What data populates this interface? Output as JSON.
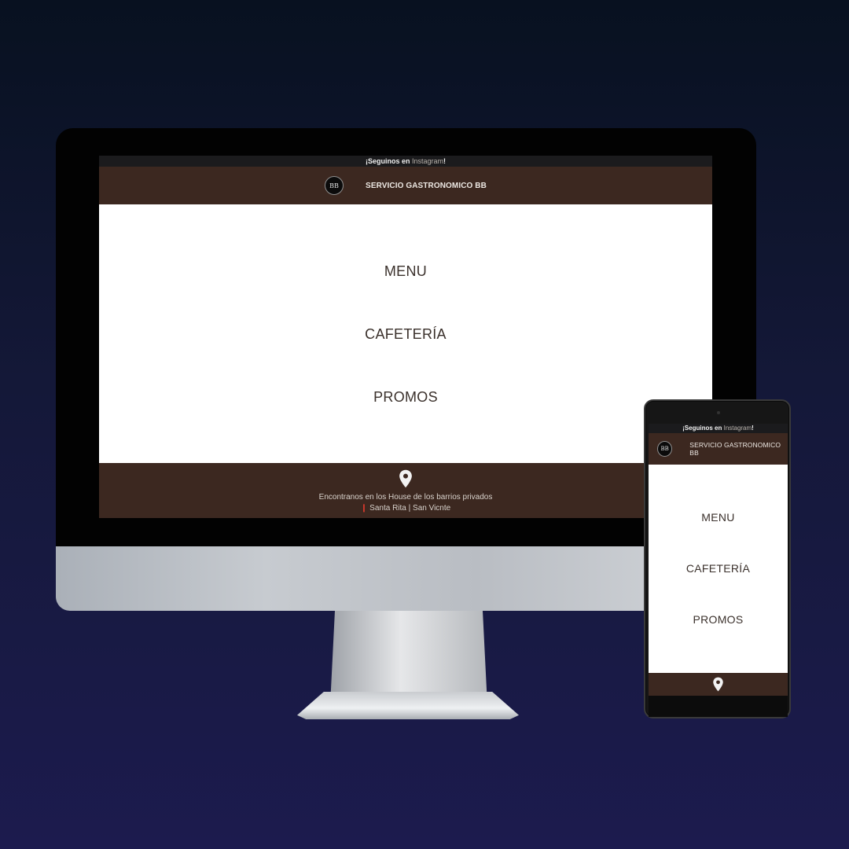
{
  "desktop": {
    "topbar": {
      "prefix": "¡Seguinos en ",
      "link": "Instagram",
      "suffix": "!"
    },
    "header": {
      "logo_text": "BB",
      "brand": "SERVICIO GASTRONOMICO BB"
    },
    "menu": [
      {
        "label": "MENU"
      },
      {
        "label": "CAFETERÍA"
      },
      {
        "label": "PROMOS"
      }
    ],
    "footer": {
      "line1": "Encontranos en los House de los barrios privados",
      "line2": "Santa Rita | San Vicnte"
    }
  },
  "mobile": {
    "topbar": {
      "prefix": "¡Seguinos en ",
      "link": "Instagram",
      "suffix": "!"
    },
    "header": {
      "logo_text": "BB",
      "brand": "SERVICIO GASTRONOMICO BB"
    },
    "menu": [
      {
        "label": "MENU"
      },
      {
        "label": "CAFETERÍA"
      },
      {
        "label": "PROMOS"
      }
    ]
  },
  "colors": {
    "brand_brown": "#3c2820",
    "background_top": "#081120",
    "background_bottom": "#1c1b4e",
    "location_pin_red": "#e23b2e"
  },
  "icons": {
    "location": "location-pin-icon",
    "logo": "bb-logo"
  }
}
